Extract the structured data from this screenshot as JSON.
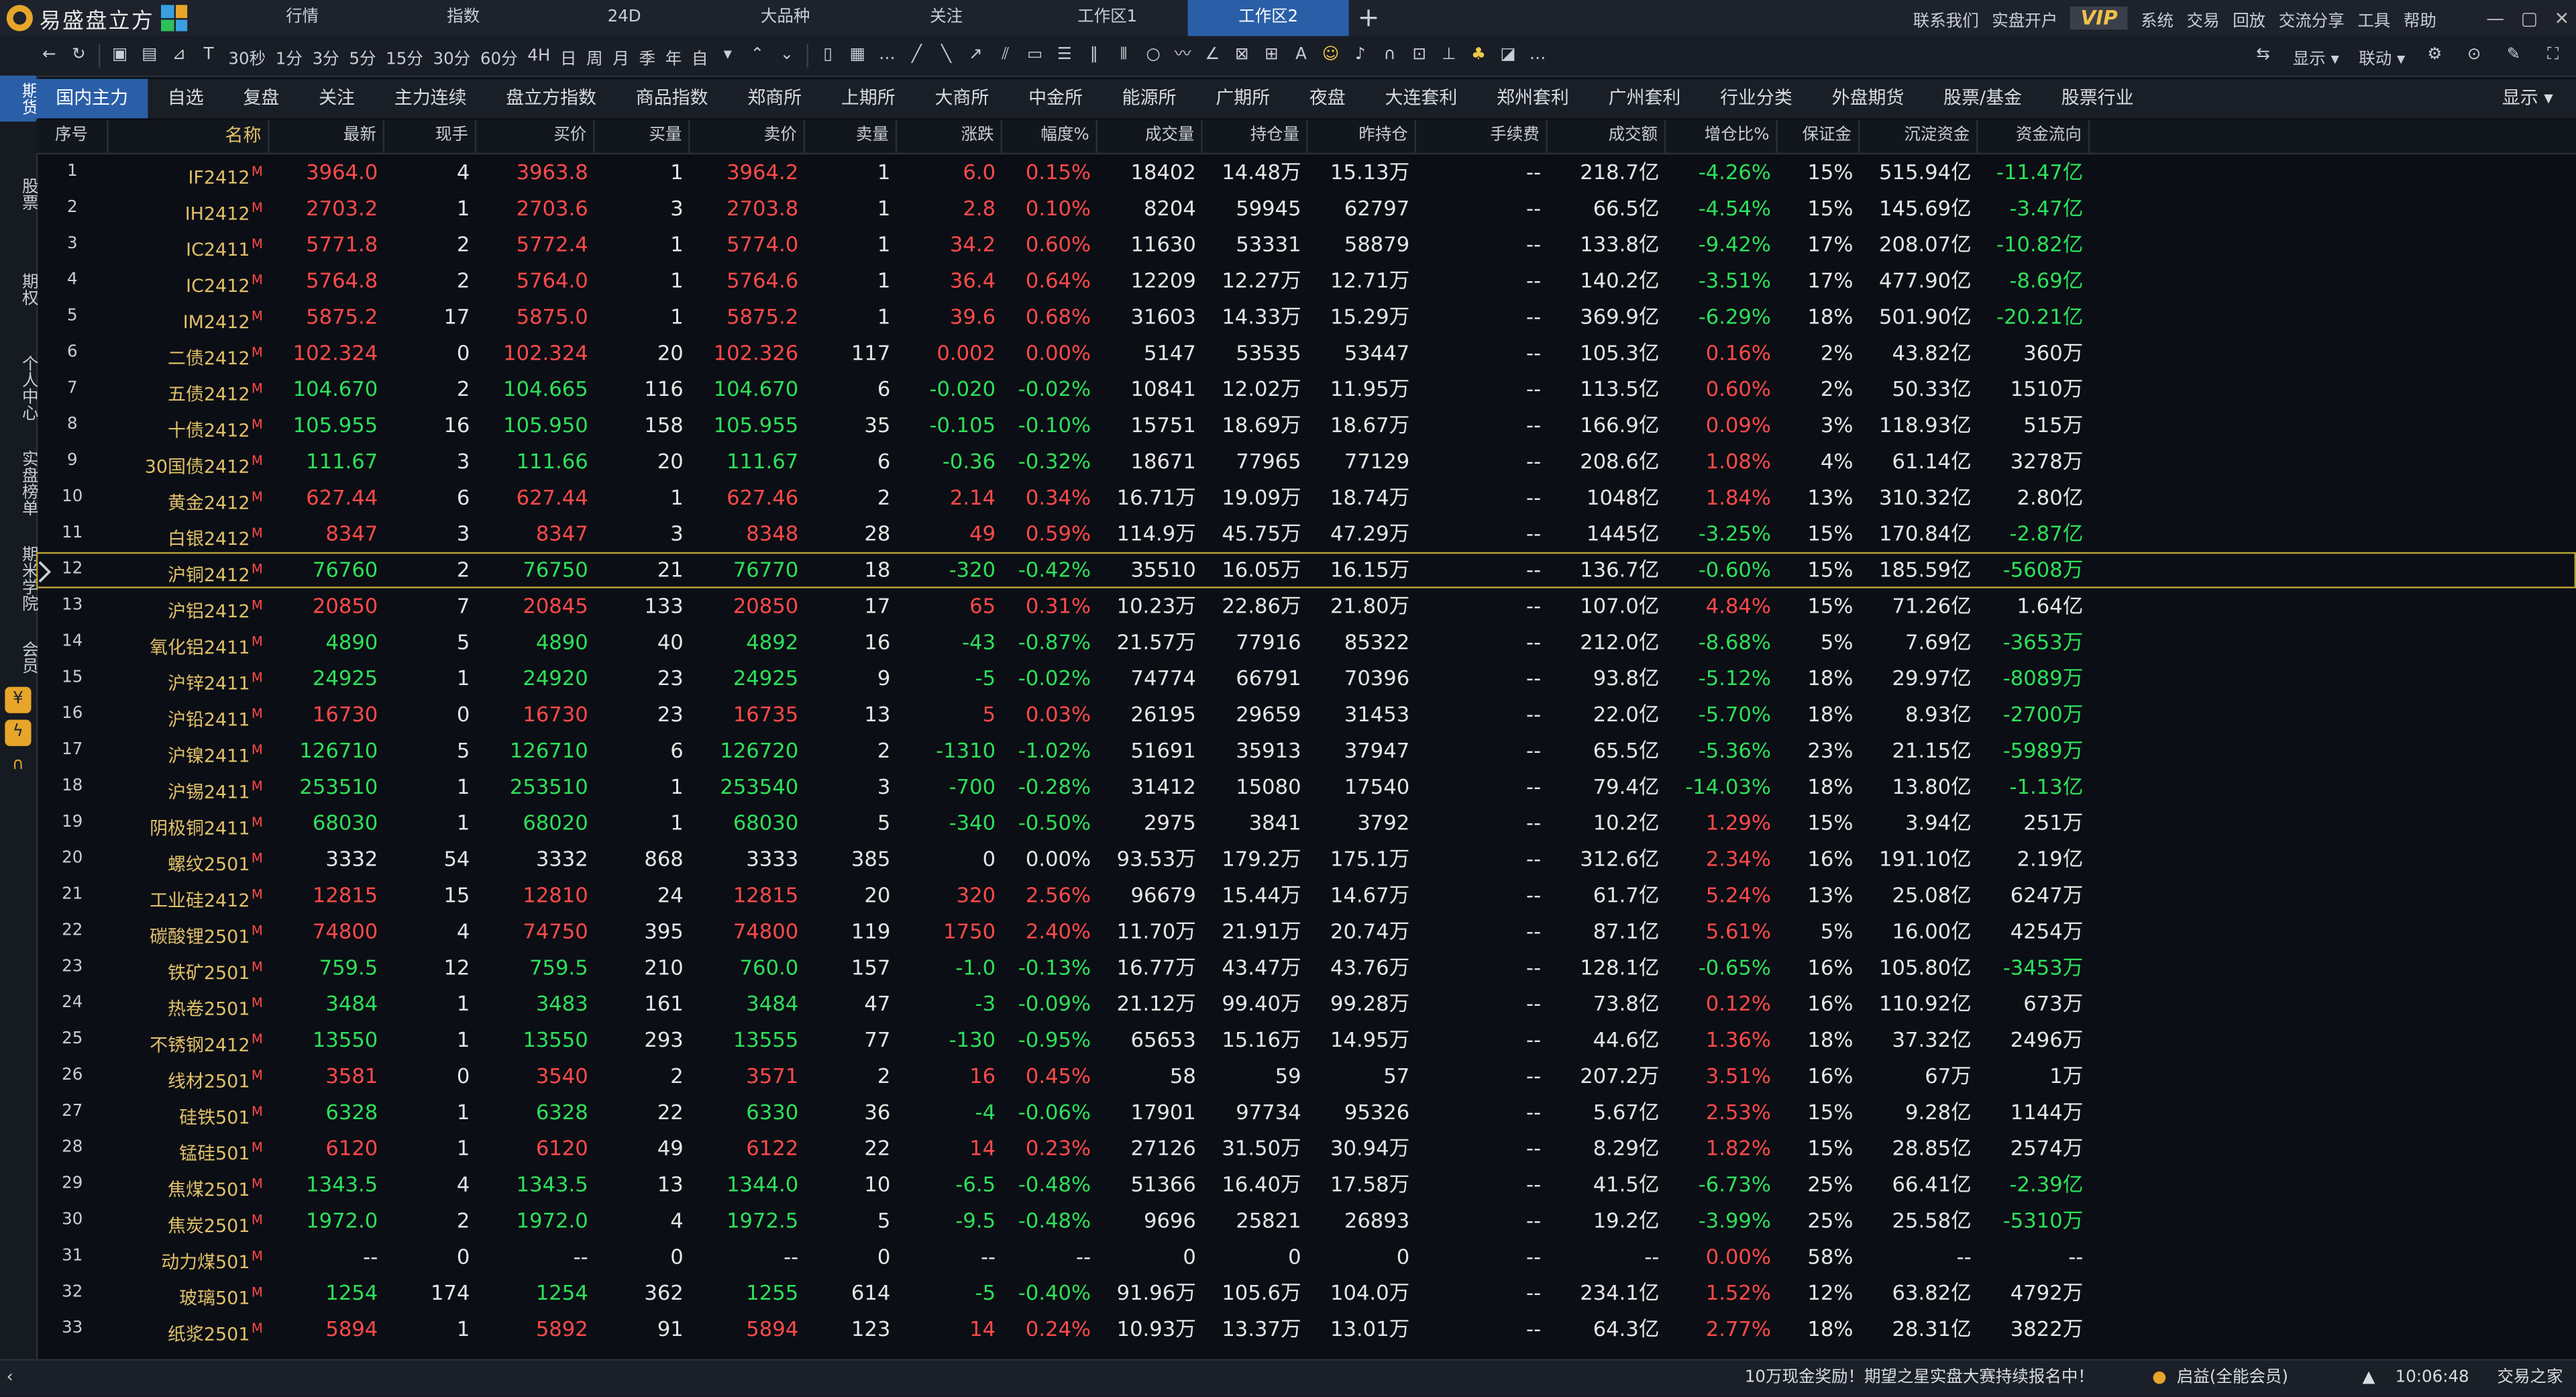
{
  "app": {
    "title": "易盛盘立方"
  },
  "top_tabs": [
    "行情",
    "指数",
    "24D",
    "大品种",
    "关注",
    "工作区1",
    "工作区2"
  ],
  "top_menu": [
    "联系我们",
    "实盘开户",
    "VIP",
    "系统",
    "交易",
    "回放",
    "交流分享",
    "工具",
    "帮助"
  ],
  "toolbar": {
    "periods": [
      "30秒",
      "1分",
      "3分",
      "5分",
      "15分",
      "30分",
      "60分",
      "4H",
      "日",
      "周",
      "月",
      "季",
      "年",
      "自"
    ],
    "display_label": "显示",
    "link_label": "联动"
  },
  "left_nav": [
    "期货",
    "股票",
    "期权",
    "个人中心",
    "实盘榜单",
    "期米学院",
    "会员"
  ],
  "category_tabs": [
    "国内主力",
    "自选",
    "复盘",
    "关注",
    "主力连续",
    "盘立方指数",
    "商品指数",
    "郑商所",
    "上期所",
    "大商所",
    "中金所",
    "能源所",
    "广期所",
    "夜盘",
    "大连套利",
    "郑州套利",
    "广州套利",
    "行业分类",
    "外盘期货",
    "股票/基金",
    "股票行业"
  ],
  "category_display": "显示",
  "columns": [
    "序号",
    "名称",
    "最新",
    "现手",
    "买价",
    "买量",
    "卖价",
    "卖量",
    "涨跌",
    "幅度%",
    "成交量",
    "持仓量",
    "昨持仓",
    "手续费",
    "成交额",
    "增仓比%",
    "保证金",
    "沉淀资金",
    "资金流向"
  ],
  "rows": [
    [
      "1",
      "IF2412",
      "3964.0",
      "4",
      "3963.8",
      "1",
      "3964.2",
      "1",
      "6.0",
      "0.15%",
      "18402",
      "14.48万",
      "15.13万",
      "--",
      "218.7亿",
      "-4.26%",
      "15%",
      "515.94亿",
      "-11.47亿"
    ],
    [
      "2",
      "IH2412",
      "2703.2",
      "1",
      "2703.6",
      "3",
      "2703.8",
      "1",
      "2.8",
      "0.10%",
      "8204",
      "59945",
      "62797",
      "--",
      "66.5亿",
      "-4.54%",
      "15%",
      "145.69亿",
      "-3.47亿"
    ],
    [
      "3",
      "IC2411",
      "5771.8",
      "2",
      "5772.4",
      "1",
      "5774.0",
      "1",
      "34.2",
      "0.60%",
      "11630",
      "53331",
      "58879",
      "--",
      "133.8亿",
      "-9.42%",
      "17%",
      "208.07亿",
      "-10.82亿"
    ],
    [
      "4",
      "IC2412",
      "5764.8",
      "2",
      "5764.0",
      "1",
      "5764.6",
      "1",
      "36.4",
      "0.64%",
      "12209",
      "12.27万",
      "12.71万",
      "--",
      "140.2亿",
      "-3.51%",
      "17%",
      "477.90亿",
      "-8.69亿"
    ],
    [
      "5",
      "IM2412",
      "5875.2",
      "17",
      "5875.0",
      "1",
      "5875.2",
      "1",
      "39.6",
      "0.68%",
      "31603",
      "14.33万",
      "15.29万",
      "--",
      "369.9亿",
      "-6.29%",
      "18%",
      "501.90亿",
      "-20.21亿"
    ],
    [
      "6",
      "二债2412",
      "102.324",
      "0",
      "102.324",
      "20",
      "102.326",
      "117",
      "0.002",
      "0.00%",
      "5147",
      "53535",
      "53447",
      "--",
      "105.3亿",
      "0.16%",
      "2%",
      "43.82亿",
      "360万"
    ],
    [
      "7",
      "五债2412",
      "104.670",
      "2",
      "104.665",
      "116",
      "104.670",
      "6",
      "-0.020",
      "-0.02%",
      "10841",
      "12.02万",
      "11.95万",
      "--",
      "113.5亿",
      "0.60%",
      "2%",
      "50.33亿",
      "1510万"
    ],
    [
      "8",
      "十债2412",
      "105.955",
      "16",
      "105.950",
      "158",
      "105.955",
      "35",
      "-0.105",
      "-0.10%",
      "15751",
      "18.69万",
      "18.67万",
      "--",
      "166.9亿",
      "0.09%",
      "3%",
      "118.93亿",
      "515万"
    ],
    [
      "9",
      "30国债2412",
      "111.67",
      "3",
      "111.66",
      "20",
      "111.67",
      "6",
      "-0.36",
      "-0.32%",
      "18671",
      "77965",
      "77129",
      "--",
      "208.6亿",
      "1.08%",
      "4%",
      "61.14亿",
      "3278万"
    ],
    [
      "10",
      "黄金2412",
      "627.44",
      "6",
      "627.44",
      "1",
      "627.46",
      "2",
      "2.14",
      "0.34%",
      "16.71万",
      "19.09万",
      "18.74万",
      "--",
      "1048亿",
      "1.84%",
      "13%",
      "310.32亿",
      "2.80亿"
    ],
    [
      "11",
      "白银2412",
      "8347",
      "3",
      "8347",
      "3",
      "8348",
      "28",
      "49",
      "0.59%",
      "114.9万",
      "45.75万",
      "47.29万",
      "--",
      "1445亿",
      "-3.25%",
      "15%",
      "170.84亿",
      "-2.87亿"
    ],
    [
      "12",
      "沪铜2412",
      "76760",
      "2",
      "76750",
      "21",
      "76770",
      "18",
      "-320",
      "-0.42%",
      "35510",
      "16.05万",
      "16.15万",
      "--",
      "136.7亿",
      "-0.60%",
      "15%",
      "185.59亿",
      "-5608万"
    ],
    [
      "13",
      "沪铝2412",
      "20850",
      "7",
      "20845",
      "133",
      "20850",
      "17",
      "65",
      "0.31%",
      "10.23万",
      "22.86万",
      "21.80万",
      "--",
      "107.0亿",
      "4.84%",
      "15%",
      "71.26亿",
      "1.64亿"
    ],
    [
      "14",
      "氧化铝2411",
      "4890",
      "5",
      "4890",
      "40",
      "4892",
      "16",
      "-43",
      "-0.87%",
      "21.57万",
      "77916",
      "85322",
      "--",
      "212.0亿",
      "-8.68%",
      "5%",
      "7.69亿",
      "-3653万"
    ],
    [
      "15",
      "沪锌2411",
      "24925",
      "1",
      "24920",
      "23",
      "24925",
      "9",
      "-5",
      "-0.02%",
      "74774",
      "66791",
      "70396",
      "--",
      "93.8亿",
      "-5.12%",
      "18%",
      "29.97亿",
      "-8089万"
    ],
    [
      "16",
      "沪铅2411",
      "16730",
      "0",
      "16730",
      "23",
      "16735",
      "13",
      "5",
      "0.03%",
      "26195",
      "29659",
      "31453",
      "--",
      "22.0亿",
      "-5.70%",
      "18%",
      "8.93亿",
      "-2700万"
    ],
    [
      "17",
      "沪镍2411",
      "126710",
      "5",
      "126710",
      "6",
      "126720",
      "2",
      "-1310",
      "-1.02%",
      "51691",
      "35913",
      "37947",
      "--",
      "65.5亿",
      "-5.36%",
      "23%",
      "21.15亿",
      "-5989万"
    ],
    [
      "18",
      "沪锡2411",
      "253510",
      "1",
      "253510",
      "1",
      "253540",
      "3",
      "-700",
      "-0.28%",
      "31412",
      "15080",
      "17540",
      "--",
      "79.4亿",
      "-14.03%",
      "18%",
      "13.80亿",
      "-1.13亿"
    ],
    [
      "19",
      "阴极铜2411",
      "68030",
      "1",
      "68020",
      "1",
      "68030",
      "5",
      "-340",
      "-0.50%",
      "2975",
      "3841",
      "3792",
      "--",
      "10.2亿",
      "1.29%",
      "15%",
      "3.94亿",
      "251万"
    ],
    [
      "20",
      "螺纹2501",
      "3332",
      "54",
      "3332",
      "868",
      "3333",
      "385",
      "0",
      "0.00%",
      "93.53万",
      "179.2万",
      "175.1万",
      "--",
      "312.6亿",
      "2.34%",
      "16%",
      "191.10亿",
      "2.19亿"
    ],
    [
      "21",
      "工业硅2412",
      "12815",
      "15",
      "12810",
      "24",
      "12815",
      "20",
      "320",
      "2.56%",
      "96679",
      "15.44万",
      "14.67万",
      "--",
      "61.7亿",
      "5.24%",
      "13%",
      "25.08亿",
      "6247万"
    ],
    [
      "22",
      "碳酸锂2501",
      "74800",
      "4",
      "74750",
      "395",
      "74800",
      "119",
      "1750",
      "2.40%",
      "11.70万",
      "21.91万",
      "20.74万",
      "--",
      "87.1亿",
      "5.61%",
      "5%",
      "16.00亿",
      "4254万"
    ],
    [
      "23",
      "铁矿2501",
      "759.5",
      "12",
      "759.5",
      "210",
      "760.0",
      "157",
      "-1.0",
      "-0.13%",
      "16.77万",
      "43.47万",
      "43.76万",
      "--",
      "128.1亿",
      "-0.65%",
      "16%",
      "105.80亿",
      "-3453万"
    ],
    [
      "24",
      "热卷2501",
      "3484",
      "1",
      "3483",
      "161",
      "3484",
      "47",
      "-3",
      "-0.09%",
      "21.12万",
      "99.40万",
      "99.28万",
      "--",
      "73.8亿",
      "0.12%",
      "16%",
      "110.92亿",
      "673万"
    ],
    [
      "25",
      "不锈钢2412",
      "13550",
      "1",
      "13550",
      "293",
      "13555",
      "77",
      "-130",
      "-0.95%",
      "65653",
      "15.16万",
      "14.95万",
      "--",
      "44.6亿",
      "1.36%",
      "18%",
      "37.32亿",
      "2496万"
    ],
    [
      "26",
      "线材2501",
      "3581",
      "0",
      "3540",
      "2",
      "3571",
      "2",
      "16",
      "0.45%",
      "58",
      "59",
      "57",
      "--",
      "207.2万",
      "3.51%",
      "16%",
      "67万",
      "1万"
    ],
    [
      "27",
      "硅铁501",
      "6328",
      "1",
      "6328",
      "22",
      "6330",
      "36",
      "-4",
      "-0.06%",
      "17901",
      "97734",
      "95326",
      "--",
      "5.67亿",
      "2.53%",
      "15%",
      "9.28亿",
      "1144万"
    ],
    [
      "28",
      "锰硅501",
      "6120",
      "1",
      "6120",
      "49",
      "6122",
      "22",
      "14",
      "0.23%",
      "27126",
      "31.50万",
      "30.94万",
      "--",
      "8.29亿",
      "1.82%",
      "15%",
      "28.85亿",
      "2574万"
    ],
    [
      "29",
      "焦煤2501",
      "1343.5",
      "4",
      "1343.5",
      "13",
      "1344.0",
      "10",
      "-6.5",
      "-0.48%",
      "51366",
      "16.40万",
      "17.58万",
      "--",
      "41.5亿",
      "-6.73%",
      "25%",
      "66.41亿",
      "-2.39亿"
    ],
    [
      "30",
      "焦炭2501",
      "1972.0",
      "2",
      "1972.0",
      "4",
      "1972.5",
      "5",
      "-9.5",
      "-0.48%",
      "9696",
      "25821",
      "26893",
      "--",
      "19.2亿",
      "-3.99%",
      "25%",
      "25.58亿",
      "-5310万"
    ],
    [
      "31",
      "动力煤501",
      "--",
      "0",
      "--",
      "0",
      "--",
      "0",
      "--",
      "--",
      "0",
      "0",
      "0",
      "--",
      "--",
      "0.00%",
      "58%",
      "--",
      "--"
    ],
    [
      "32",
      "玻璃501",
      "1254",
      "174",
      "1254",
      "362",
      "1255",
      "614",
      "-5",
      "-0.40%",
      "91.96万",
      "105.6万",
      "104.0万",
      "--",
      "234.1亿",
      "1.52%",
      "12%",
      "63.82亿",
      "4792万"
    ],
    [
      "33",
      "纸浆2501",
      "5894",
      "1",
      "5892",
      "91",
      "5894",
      "123",
      "14",
      "0.24%",
      "10.93万",
      "13.37万",
      "13.01万",
      "--",
      "64.3亿",
      "2.77%",
      "18%",
      "28.31亿",
      "3822万"
    ]
  ],
  "name_badge": "M",
  "selected_row": "12",
  "status": {
    "promo": "10万现金奖励！期望之星实盘大赛持续报名中！",
    "account": "启益(全能会员)",
    "time": "10:06:48",
    "right": "交易之家"
  },
  "colors": {
    "up": "#ff4a4a",
    "down": "#2ee05a",
    "accent": "#2a5fa8",
    "name": "#e0c06a"
  }
}
